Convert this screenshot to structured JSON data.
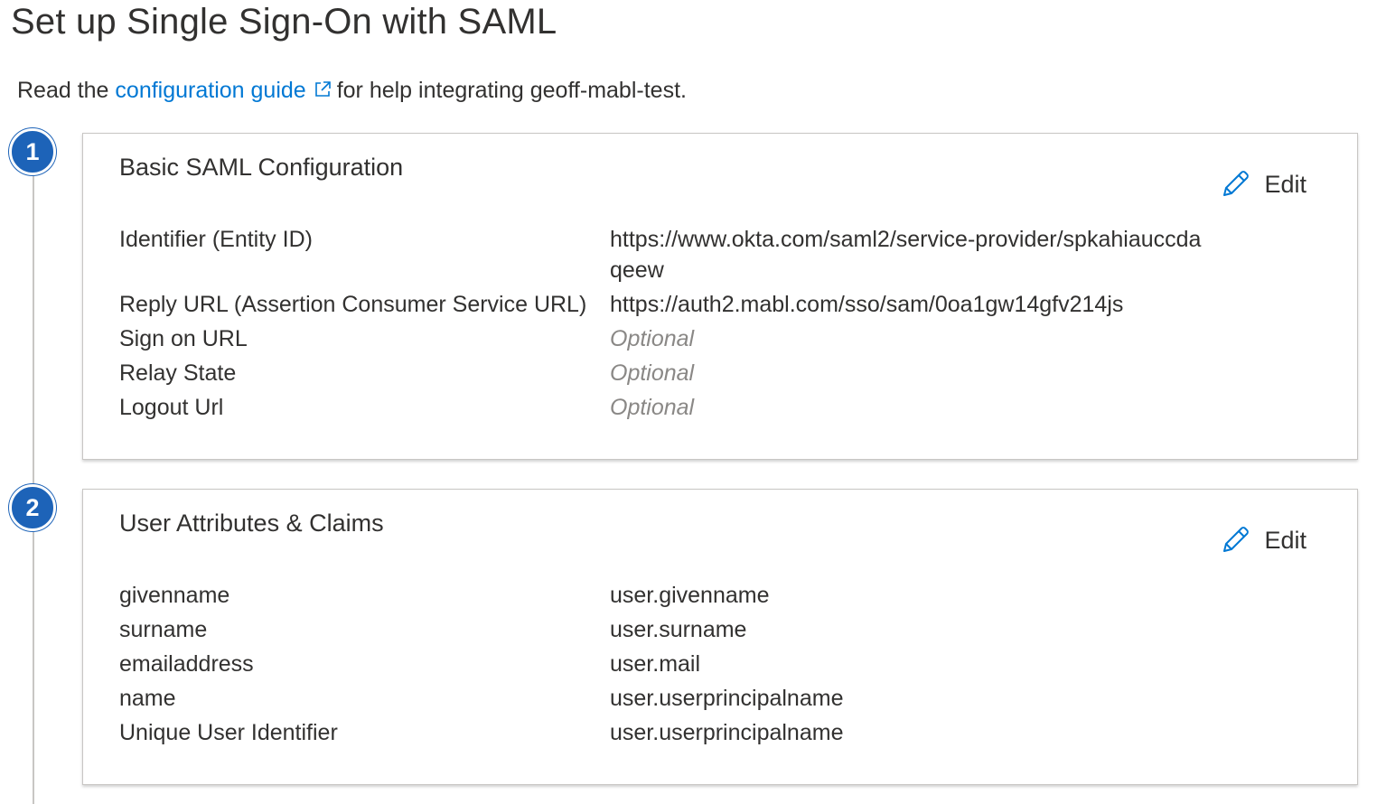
{
  "page": {
    "title": "Set up Single Sign-On with SAML"
  },
  "intro": {
    "prefix": "Read the",
    "link_text": "configuration guide",
    "suffix": "for help integrating geoff-mabl-test."
  },
  "colors": {
    "accent": "#0078d4",
    "step_circle": "#1d63b8",
    "optional_text": "#8a8886"
  },
  "sections": [
    {
      "step": "1",
      "title": "Basic SAML Configuration",
      "edit_label": "Edit",
      "rows": [
        {
          "key": "Identifier (Entity ID)",
          "value": "https://www.okta.com/saml2/service-provider/spkahiauccdaqeew",
          "optional": false
        },
        {
          "key": "Reply URL (Assertion Consumer Service URL)",
          "value": "https://auth2.mabl.com/sso/sam/0oa1gw14gfv214js",
          "optional": false
        },
        {
          "key": "Sign on URL",
          "value": "Optional",
          "optional": true
        },
        {
          "key": "Relay State",
          "value": "Optional",
          "optional": true
        },
        {
          "key": "Logout Url",
          "value": "Optional",
          "optional": true
        }
      ]
    },
    {
      "step": "2",
      "title": "User Attributes & Claims",
      "edit_label": "Edit",
      "rows": [
        {
          "key": "givenname",
          "value": "user.givenname",
          "optional": false
        },
        {
          "key": "surname",
          "value": "user.surname",
          "optional": false
        },
        {
          "key": "emailaddress",
          "value": "user.mail",
          "optional": false
        },
        {
          "key": "name",
          "value": "user.userprincipalname",
          "optional": false
        },
        {
          "key": "Unique User Identifier",
          "value": "user.userprincipalname",
          "optional": false
        }
      ]
    }
  ],
  "icons": {
    "external_link": "external-link-icon",
    "edit": "pencil-icon"
  }
}
